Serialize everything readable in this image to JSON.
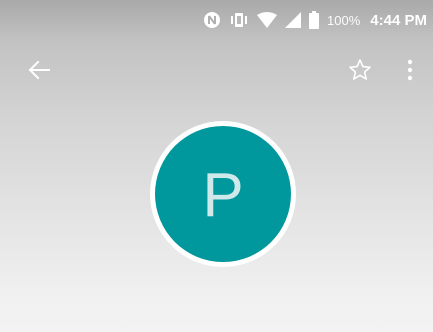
{
  "status_bar": {
    "battery_percent": "100%",
    "time": "4:44 PM",
    "icons": [
      "nfc-icon",
      "vibrate-icon",
      "wifi-icon",
      "cell-signal-icon",
      "battery-icon"
    ]
  },
  "toolbar": {
    "back_icon": "arrow-back-icon",
    "star_icon": "star-outline-icon",
    "more_icon": "more-vert-icon"
  },
  "contact": {
    "avatar_letter": "P",
    "avatar_color": "#00979d"
  }
}
